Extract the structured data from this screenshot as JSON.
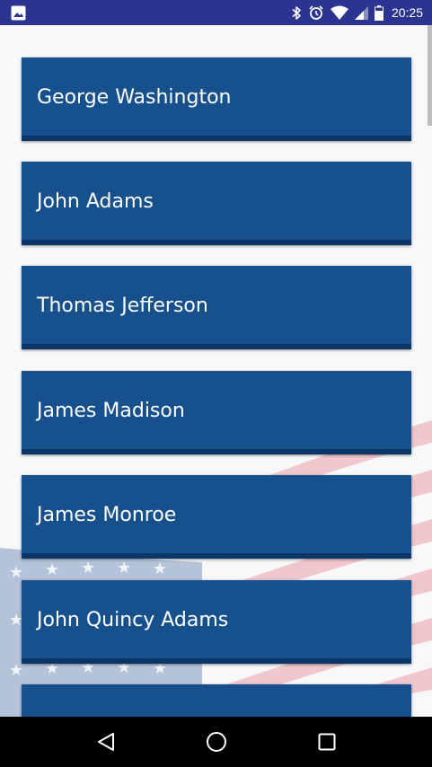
{
  "status_bar": {
    "time": "20:25",
    "background": "#2b3591",
    "icons": [
      "image-icon",
      "bluetooth-icon",
      "alarm-icon",
      "wifi-icon",
      "signal-icon",
      "battery-icon"
    ]
  },
  "presidents": {
    "items": [
      {
        "label": "George Washington"
      },
      {
        "label": "John Adams"
      },
      {
        "label": "Thomas Jefferson"
      },
      {
        "label": "James Madison"
      },
      {
        "label": "James Monroe"
      },
      {
        "label": "John Quincy Adams"
      },
      {
        "label": ""
      }
    ],
    "item_color": "#17518d"
  },
  "navigation": {
    "buttons": [
      "back-icon",
      "home-icon",
      "recents-icon"
    ]
  }
}
